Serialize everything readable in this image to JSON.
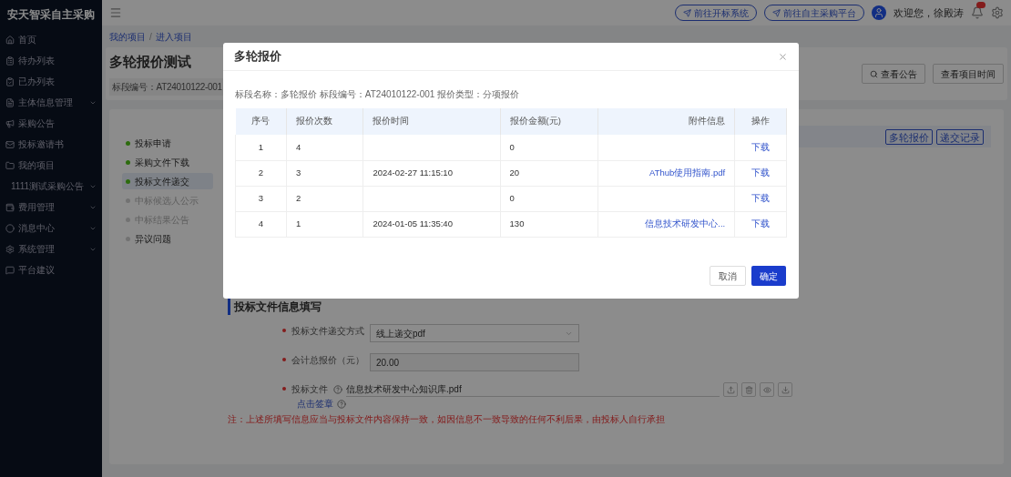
{
  "app": {
    "title": "安天智采自主采购"
  },
  "sidebar": {
    "items": [
      {
        "label": "首页",
        "expandable": false
      },
      {
        "label": "待办列表",
        "expandable": false
      },
      {
        "label": "已办列表",
        "expandable": false
      },
      {
        "label": "主体信息管理",
        "expandable": true
      },
      {
        "label": "采购公告",
        "expandable": false
      },
      {
        "label": "投标邀请书",
        "expandable": false
      },
      {
        "label": "我的项目",
        "expandable": false
      },
      {
        "label": "1111测试采购公告",
        "expandable": true
      },
      {
        "label": "费用管理",
        "expandable": true
      },
      {
        "label": "消息中心",
        "expandable": true
      },
      {
        "label": "系统管理",
        "expandable": true
      },
      {
        "label": "平台建议",
        "expandable": false
      }
    ]
  },
  "header": {
    "links": [
      "前往开标系统",
      "前往自主采购平台"
    ],
    "greeting": "欢迎您，徐殿涛"
  },
  "breadcrumb": {
    "items": [
      "我的项目",
      "进入项目"
    ],
    "separator": "/"
  },
  "project": {
    "title": "多轮报价测试",
    "code": "标段编号：AT24010122-001",
    "actions": [
      "查看公告",
      "查看项目时间"
    ]
  },
  "steps": [
    {
      "label": "投标申请",
      "done": true,
      "disabled": false,
      "selected": false
    },
    {
      "label": "采购文件下载",
      "done": true,
      "disabled": false,
      "selected": false
    },
    {
      "label": "投标文件递交",
      "done": true,
      "disabled": false,
      "selected": true
    },
    {
      "label": "中标候选人公示",
      "done": false,
      "disabled": true,
      "selected": false
    },
    {
      "label": "中标结果公告",
      "done": false,
      "disabled": true,
      "selected": false
    },
    {
      "label": "异议问题",
      "done": false,
      "disabled": false,
      "selected": false
    }
  ],
  "panel_buttons": [
    "多轮报价",
    "递交记录"
  ],
  "form": {
    "section": "投标文件信息填写",
    "fields": [
      {
        "kind": "select",
        "label": "投标文件递交方式",
        "value": "线上递交pdf"
      },
      {
        "kind": "input",
        "label": "会计总报价（元）",
        "value": "20.00"
      },
      {
        "kind": "file",
        "label": "投标文件",
        "value": "信息技术研发中心知识库.pdf",
        "link": "点击签章"
      }
    ],
    "note": "注：上述所填写信息应当与投标文件内容保持一致，如因信息不一致导致的任何不利后果，由投标人自行承担"
  },
  "dialog": {
    "title": "多轮报价",
    "info": "标段名称：多轮报价 标段编号：AT24010122-001 报价类型：分项报价",
    "columns": [
      "序号",
      "报价次数",
      "报价时间",
      "报价金额(元)",
      "附件信息",
      "操作"
    ],
    "rows": [
      [
        "1",
        "4",
        "",
        "0",
        "",
        "下载"
      ],
      [
        "2",
        "3",
        "2024-02-27 11:15:10",
        "20",
        "AThub使用指南.pdf",
        "下载"
      ],
      [
        "3",
        "2",
        "",
        "0",
        "",
        "下载"
      ],
      [
        "4",
        "1",
        "2024-01-05 11:35:40",
        "130",
        "信息技术研发中心...",
        "下载"
      ]
    ],
    "buttons": [
      "取消",
      "确定"
    ]
  }
}
